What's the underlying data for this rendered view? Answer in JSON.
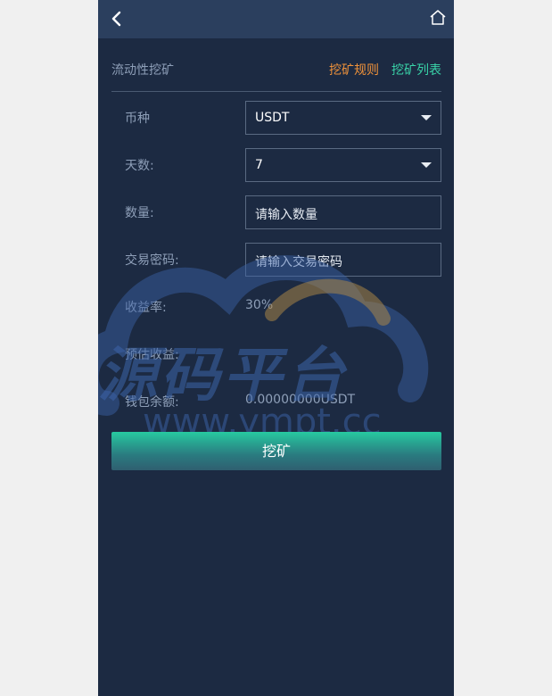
{
  "header": {
    "back_icon": "chevron-left-icon",
    "home_icon": "home-icon"
  },
  "section": {
    "title": "流动性挖矿",
    "rules_link": "挖矿规则",
    "list_link": "挖矿列表"
  },
  "form": {
    "currency": {
      "label": "币种",
      "value": "USDT"
    },
    "days": {
      "label": "天数:",
      "value": "7"
    },
    "quantity": {
      "label": "数量:",
      "placeholder": "请输入数量"
    },
    "password": {
      "label": "交易密码:",
      "placeholder": "请输入交易密码"
    },
    "yield_rate": {
      "label": "收益率:",
      "value": "30%"
    },
    "estimated": {
      "label": "预估收益:",
      "value": ""
    },
    "balance": {
      "label": "钱包余额:",
      "value": "0.00000000USDT"
    }
  },
  "actions": {
    "mine_label": "挖矿"
  },
  "watermark": {
    "text": "源码平台",
    "url": "www.ympt.cc"
  },
  "colors": {
    "page_bg": "#1c2a42",
    "topbar_bg": "#2b3f5e",
    "rules_link": "#f0923a",
    "list_link": "#39d3a8",
    "button_top": "#27c9a0",
    "button_bottom": "#2f5f70"
  }
}
